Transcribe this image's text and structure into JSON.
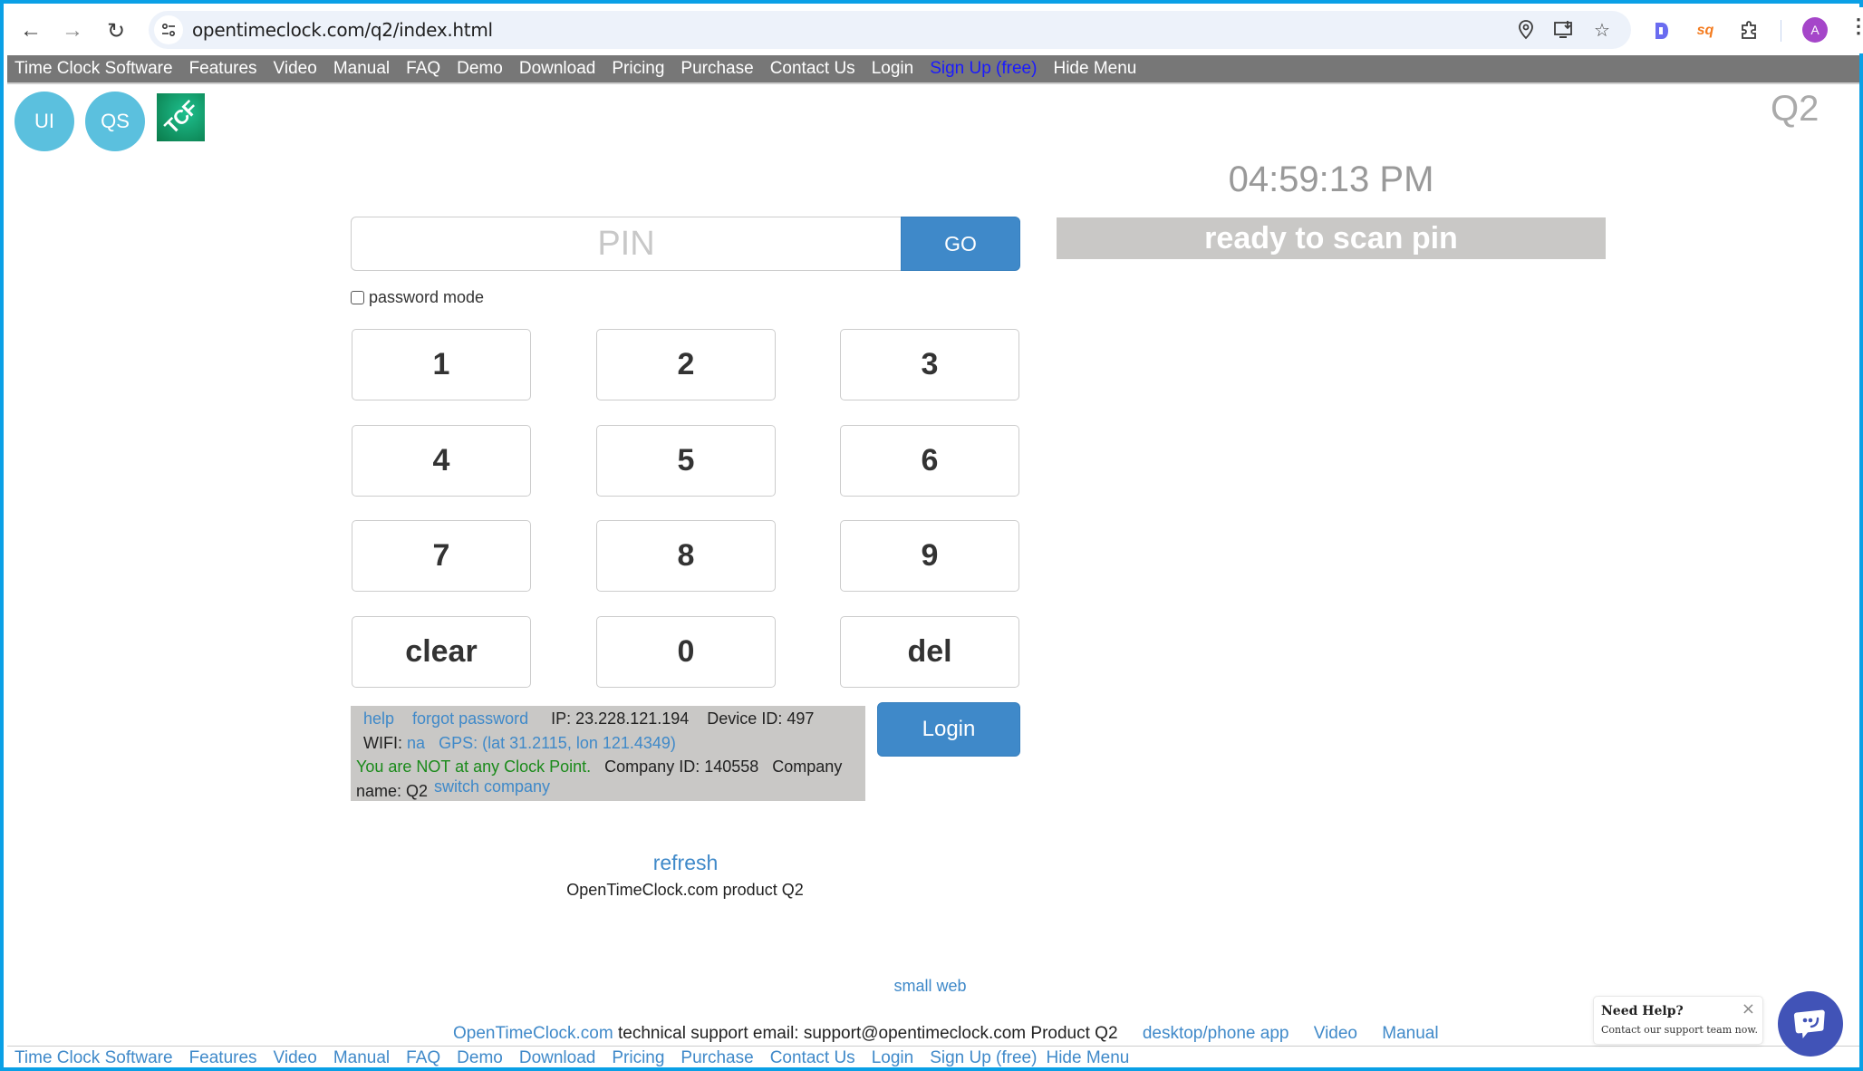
{
  "browser": {
    "url": "opentimeclock.com/q2/index.html",
    "profile_initial": "A",
    "icons": [
      "back-icon",
      "forward-icon",
      "reload-icon",
      "site-info-icon",
      "location-icon",
      "install-app-icon",
      "bookmark-star-icon",
      "extension-d-icon",
      "extension-sq-icon",
      "extensions-puzzle-icon",
      "menu-kebab-icon"
    ]
  },
  "topnav": {
    "items": [
      "Time Clock Software",
      "Features",
      "Video",
      "Manual",
      "FAQ",
      "Demo",
      "Download",
      "Pricing",
      "Purchase",
      "Contact Us",
      "Login",
      "Sign Up (free)",
      "Hide Menu"
    ],
    "highlight_color": "#1a1aff"
  },
  "header": {
    "circle_ui": "UI",
    "circle_qs": "QS",
    "logo_text": "TCF",
    "company_code": "Q2"
  },
  "pin": {
    "placeholder": "PIN",
    "value": "",
    "go_label": "GO",
    "password_mode_label": "password mode",
    "password_mode_checked": false
  },
  "clock": {
    "time": "04:59:13 PM",
    "status": "ready to scan pin"
  },
  "keypad": {
    "keys": [
      "1",
      "2",
      "3",
      "4",
      "5",
      "6",
      "7",
      "8",
      "9",
      "clear",
      "0",
      "del"
    ]
  },
  "info": {
    "help": "help",
    "forgot_password": "forgot password",
    "ip": "IP: 23.228.121.194",
    "device_id": "Device ID: 497",
    "wifi_label": "WIFI:",
    "wifi_value": "na",
    "gps": "GPS: (lat 31.2115, lon 121.4349)",
    "clock_point": "You are NOT at any Clock Point.",
    "company_id": "Company ID: 140558",
    "company_name_label": "Company name: Q2",
    "switch_company": "switch company"
  },
  "login_label": "Login",
  "refresh_label": "refresh",
  "product_label": "OpenTimeClock.com product Q2",
  "small_web_label": "small web",
  "footer": {
    "site_link": "OpenTimeClock.com",
    "support_text": "technical support email: support@opentimeclock.com Product Q2",
    "links": [
      "desktop/phone app",
      "Video",
      "Manual"
    ]
  },
  "bottomnav": {
    "items": [
      "Time Clock Software",
      "Features",
      "Video",
      "Manual",
      "FAQ",
      "Demo",
      "Download",
      "Pricing",
      "Purchase",
      "Contact Us",
      "Login",
      "Sign Up (free)",
      "Hide Menu"
    ]
  },
  "help_popup": {
    "title": "Need Help?",
    "subtitle": "Contact our support team now.",
    "close": "×"
  },
  "colors": {
    "primary_button": "#3f89c9",
    "nav_bg": "#777777",
    "status_bg": "#c9c8c6",
    "circle": "#5bc0de",
    "chat": "#4153b7"
  }
}
